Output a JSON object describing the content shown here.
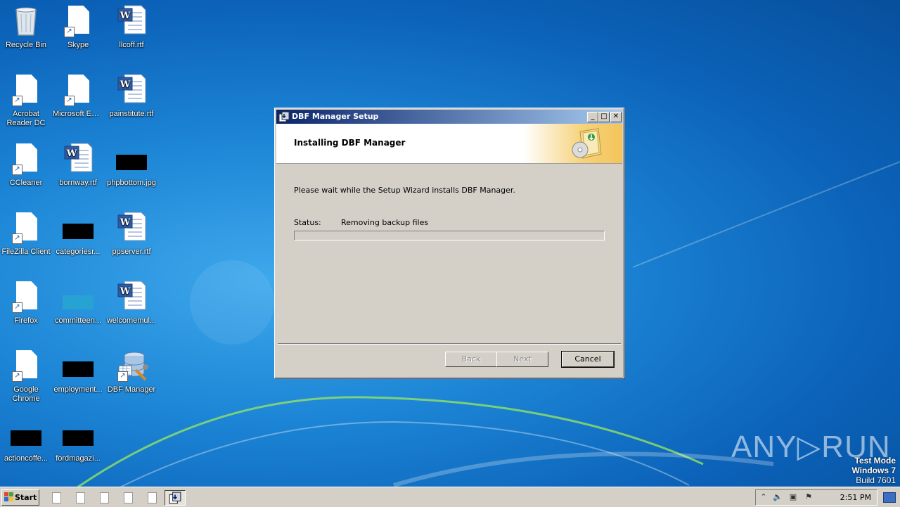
{
  "desktop": {
    "icons": [
      {
        "label": "Recycle Bin",
        "kind": "recycle-bin-icon"
      },
      {
        "label": "Skype",
        "kind": "file-shortcut-icon"
      },
      {
        "label": "llcoff.rtf",
        "kind": "word-document-icon"
      },
      {
        "label": "Acrobat Reader DC",
        "kind": "file-shortcut-icon"
      },
      {
        "label": "Microsoft Edge",
        "kind": "file-shortcut-icon"
      },
      {
        "label": "painstitute.rtf",
        "kind": "word-document-icon"
      },
      {
        "label": "CCleaner",
        "kind": "file-shortcut-icon"
      },
      {
        "label": "bornway.rtf",
        "kind": "word-document-icon"
      },
      {
        "label": "phpbottom.jpg",
        "kind": "image-thumbnail-icon"
      },
      {
        "label": "FileZilla Client",
        "kind": "file-shortcut-icon"
      },
      {
        "label": "categoriesr...",
        "kind": "image-thumbnail-icon"
      },
      {
        "label": "ppserver.rtf",
        "kind": "word-document-icon"
      },
      {
        "label": "Firefox",
        "kind": "file-shortcut-icon"
      },
      {
        "label": "committeen...",
        "kind": "image-thumbnail-icon"
      },
      {
        "label": "welcomemul...",
        "kind": "word-document-icon"
      },
      {
        "label": "Google Chrome",
        "kind": "file-shortcut-icon"
      },
      {
        "label": "employment...",
        "kind": "image-thumbnail-icon"
      },
      {
        "label": "DBF Manager",
        "kind": "dbf-manager-icon"
      },
      {
        "label": "actioncoffe...",
        "kind": "image-thumbnail-icon"
      },
      {
        "label": "fordmagazi...",
        "kind": "image-thumbnail-icon"
      }
    ]
  },
  "dialog": {
    "title": "DBF Manager Setup",
    "header_title": "Installing DBF Manager",
    "message": "Please wait while the Setup Wizard installs DBF Manager.",
    "status_label": "Status:",
    "status_value": "Removing backup files",
    "progress_fraction": 0.0,
    "buttons": {
      "back": "Back",
      "next": "Next",
      "cancel": "Cancel"
    },
    "title_buttons": {
      "minimize": "_",
      "maximize": "□",
      "close": "✕"
    }
  },
  "taskbar": {
    "start_label": "Start",
    "clock": "2:51 PM"
  },
  "watermark": {
    "line1": "Test Mode",
    "line2": "Windows 7",
    "line3": "Build 7601",
    "brand": "ANY▷RUN"
  }
}
